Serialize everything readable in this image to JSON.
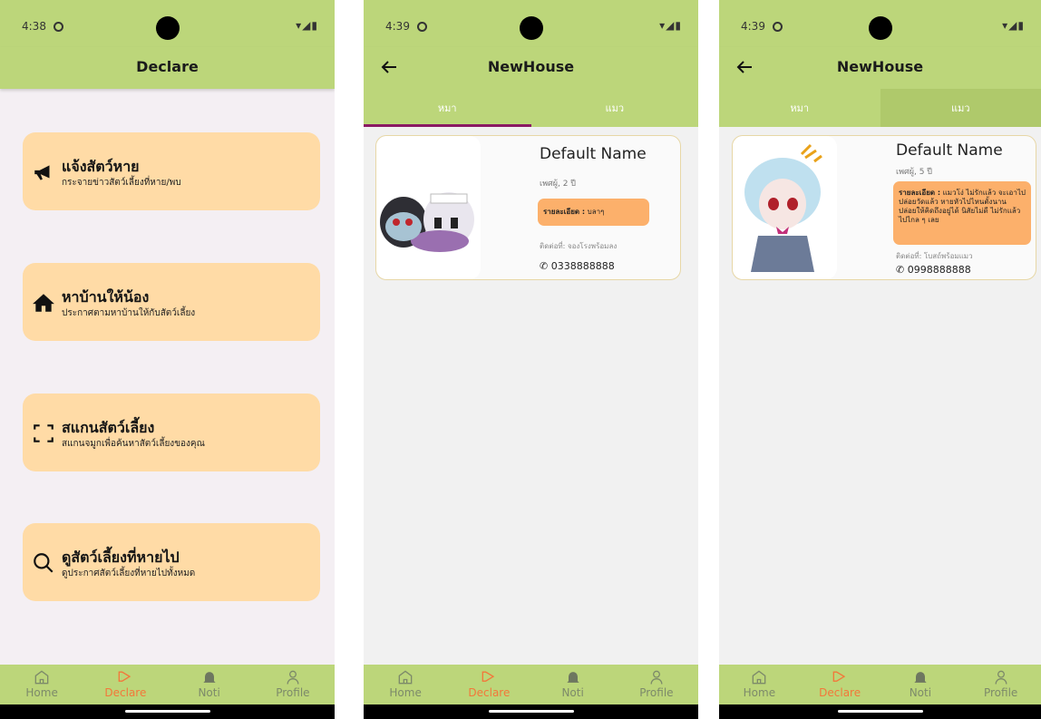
{
  "screens": [
    {
      "status_time": "4:38",
      "title": "Declare",
      "menu": [
        {
          "title": "แจ้งสัตว์หาย",
          "subtitle": "กระจายข่าวสัตว์เลี้ยงที่หาย/พบ",
          "icon": "megaphone-icon"
        },
        {
          "title": "หาบ้านให้น้อง",
          "subtitle": "ประกาศตามหาบ้านให้กับสัตว์เลี้ยง",
          "icon": "home-icon"
        },
        {
          "title": "สแกนสัตว์เลี้ยง",
          "subtitle": "สแกนจมูกเพื่อค้นหาสัตว์เลี้ยงของคุณ",
          "icon": "scan-icon"
        },
        {
          "title": "ดูสัตว์เลี้ยงที่หายไป",
          "subtitle": "ดูประกาศสัตว์เลี้ยงที่หายไปทั้งหมด",
          "icon": "search-icon"
        }
      ]
    },
    {
      "status_time": "4:39",
      "title": "NewHouse",
      "tabs": [
        "หมา",
        "แมว"
      ],
      "active_tab": 0,
      "pet": {
        "name": "Default Name",
        "meta": "เพศผู้, 2 ปี",
        "detail_label": "รายละเอียด :",
        "detail_text": "บลาๆ",
        "contact": "ติดต่อที่: จองโรงพร้อมลง",
        "phone": "0338888888"
      }
    },
    {
      "status_time": "4:39",
      "title": "NewHouse",
      "tabs": [
        "หมา",
        "แมว"
      ],
      "active_tab": 1,
      "pet": {
        "name": "Default Name",
        "meta": "เพศผู้, 5 ปี",
        "detail_label": "รายละเอียด :",
        "detail_text": "แมวโง่ ไม่รักแล้ว จะเอาไปปล่อยวัดแล้ว หายหัวไปไหนตั้งนาน ปล่อยให้คิดถึงอยู่ได้ นิสัยไม่ดี ไม่รักแล้ว ไปไกล ๆ เลย",
        "contact": "ติดต่อที่: โบสถ์พร้อมแมว",
        "phone": "0998888888"
      }
    }
  ],
  "nav": [
    {
      "label": "Home",
      "icon": "home-outline-icon"
    },
    {
      "label": "Declare",
      "icon": "megaphone-outline-icon"
    },
    {
      "label": "Noti",
      "icon": "bell-icon"
    },
    {
      "label": "Profile",
      "icon": "person-icon"
    }
  ],
  "colors": {
    "bar": "#bcd67a",
    "card": "#ffdba6",
    "detail": "#fcb06b",
    "active_nav": "#f3773a",
    "tab_indicator": "#8a1a63"
  }
}
